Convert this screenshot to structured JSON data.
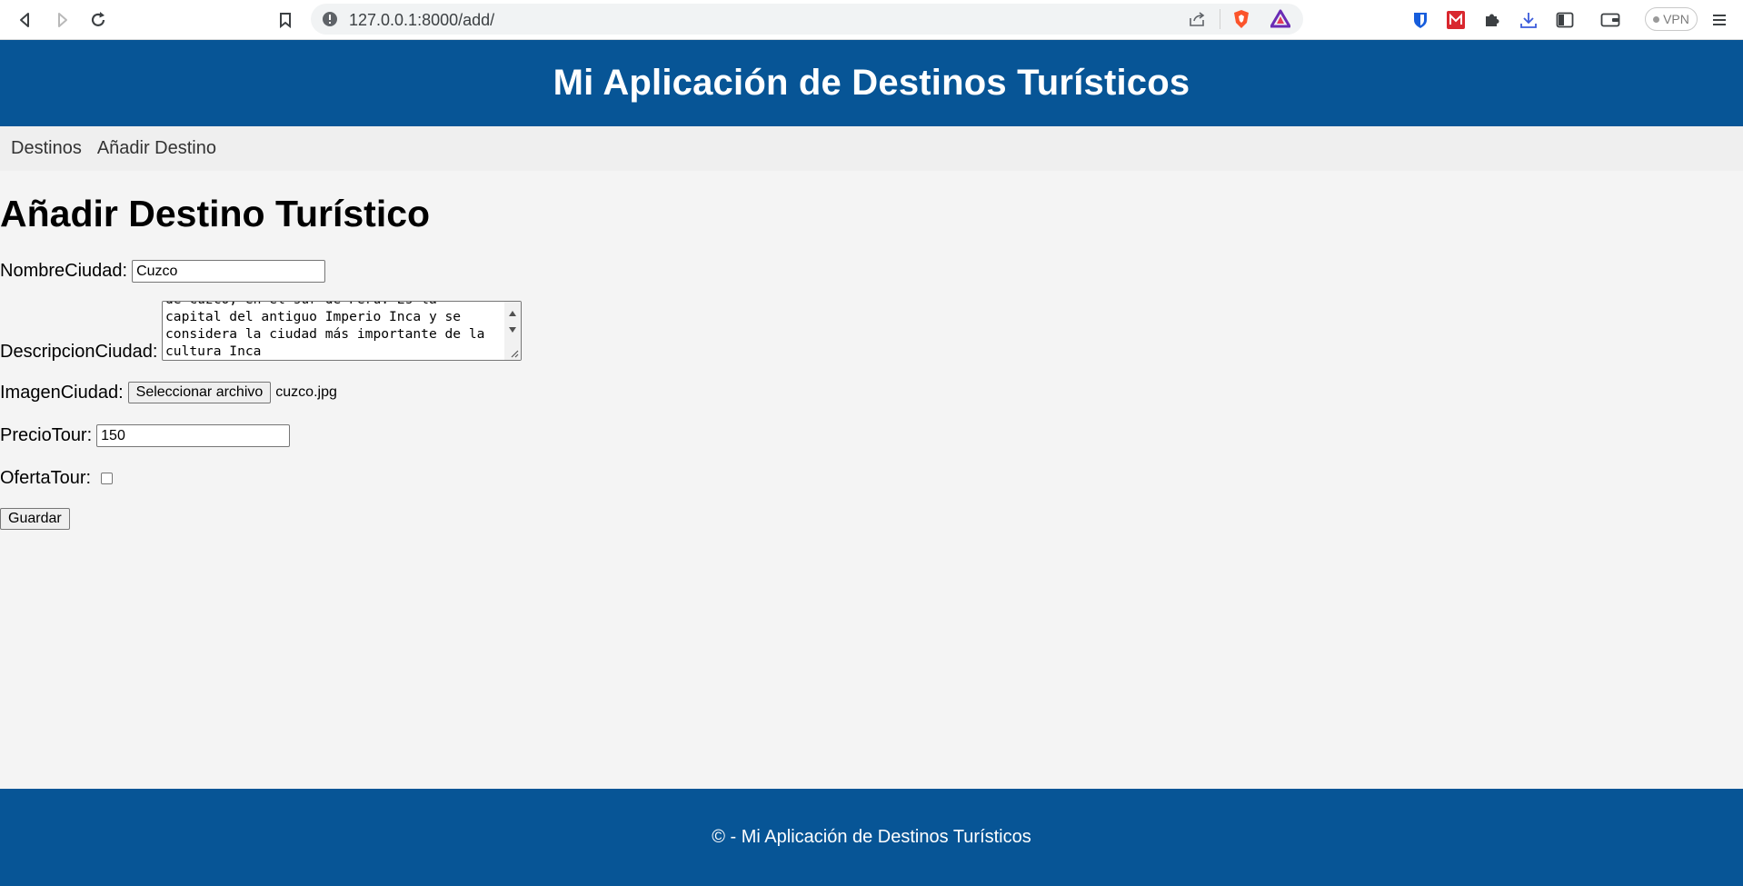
{
  "browser": {
    "url": "127.0.0.1:8000/add/",
    "vpn_label": "VPN"
  },
  "header": {
    "title": "Mi Aplicación de Destinos Turísticos"
  },
  "nav": {
    "items": [
      {
        "label": "Destinos"
      },
      {
        "label": "Añadir Destino"
      }
    ]
  },
  "form": {
    "title": "Añadir Destino Turístico",
    "nombre_label": "NombreCiudad:",
    "nombre_value": "Cuzco",
    "descripcion_label": "DescripcionCiudad:",
    "descripcion_value": "de Cuzco, en el sur de Perú. Es la\ncapital del antiguo Imperio Inca y se\nconsidera la ciudad más importante de la\ncultura Inca",
    "imagen_label": "ImagenCiudad:",
    "imagen_button": "Seleccionar archivo",
    "imagen_filename": "cuzco.jpg",
    "precio_label": "PrecioTour:",
    "precio_value": "150",
    "oferta_label": "OfertaTour:",
    "oferta_checked": false,
    "submit_label": "Guardar"
  },
  "footer": {
    "text": "© - Mi Aplicación de Destinos Turísticos"
  },
  "colors": {
    "brand": "#075596",
    "background": "#f4f4f4",
    "nav_bg": "#efefef"
  }
}
